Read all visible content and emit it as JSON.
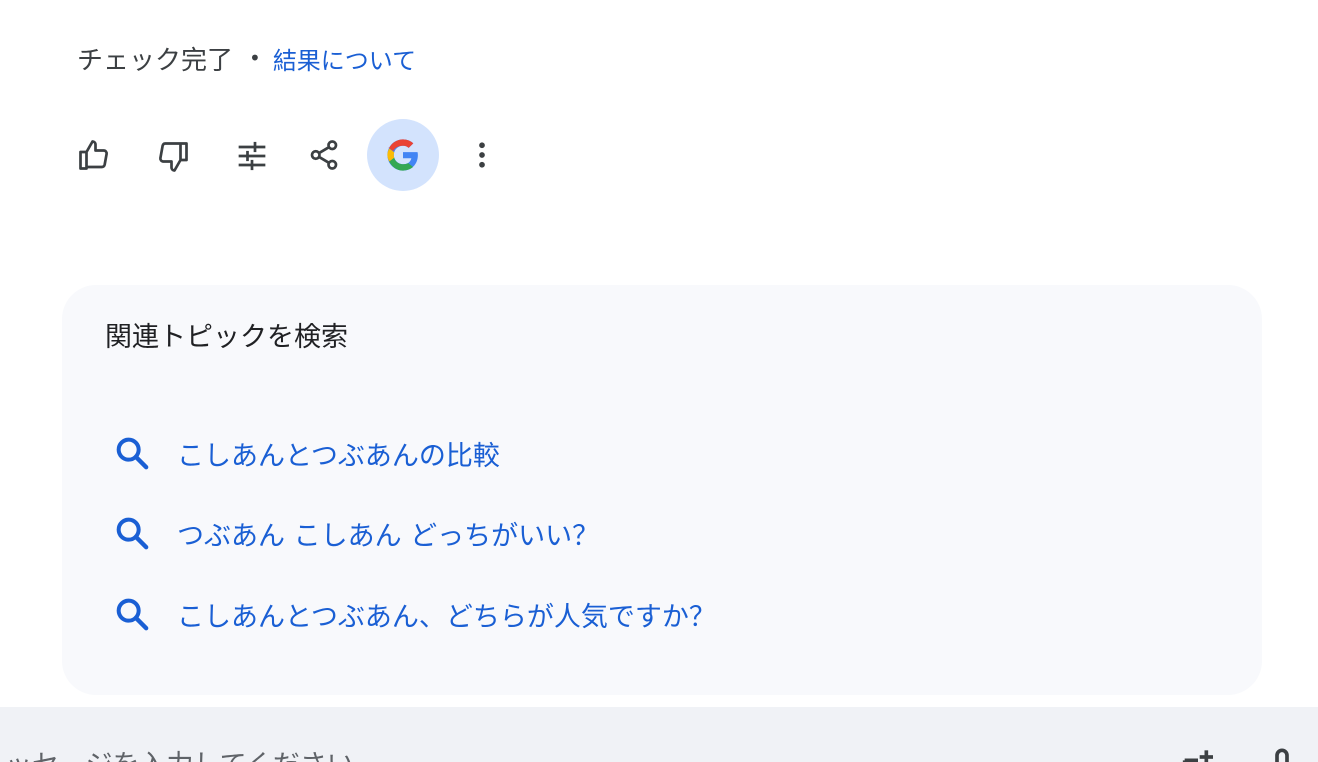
{
  "status": {
    "text": "チェック完了",
    "separator": "•",
    "link": "結果について"
  },
  "toolbar": {
    "icons": [
      "thumb-up-icon",
      "thumb-down-icon",
      "tune-icon",
      "share-icon",
      "google-icon",
      "more-vert-icon"
    ]
  },
  "related": {
    "title": "関連トピックを検索",
    "suggestions": [
      "こしあんとつぶあんの比較",
      "つぶあん こしあん どっちがいい？",
      "こしあんとつぶあん、どちらが人気ですか？"
    ]
  },
  "composer": {
    "placeholder": "メッセージを入力してください"
  },
  "colors": {
    "link": "#1a5fd4",
    "card_bg": "#f8f9fc",
    "google_btn_bg": "#d3e3fd",
    "composer_bg": "#f0f2f6"
  }
}
